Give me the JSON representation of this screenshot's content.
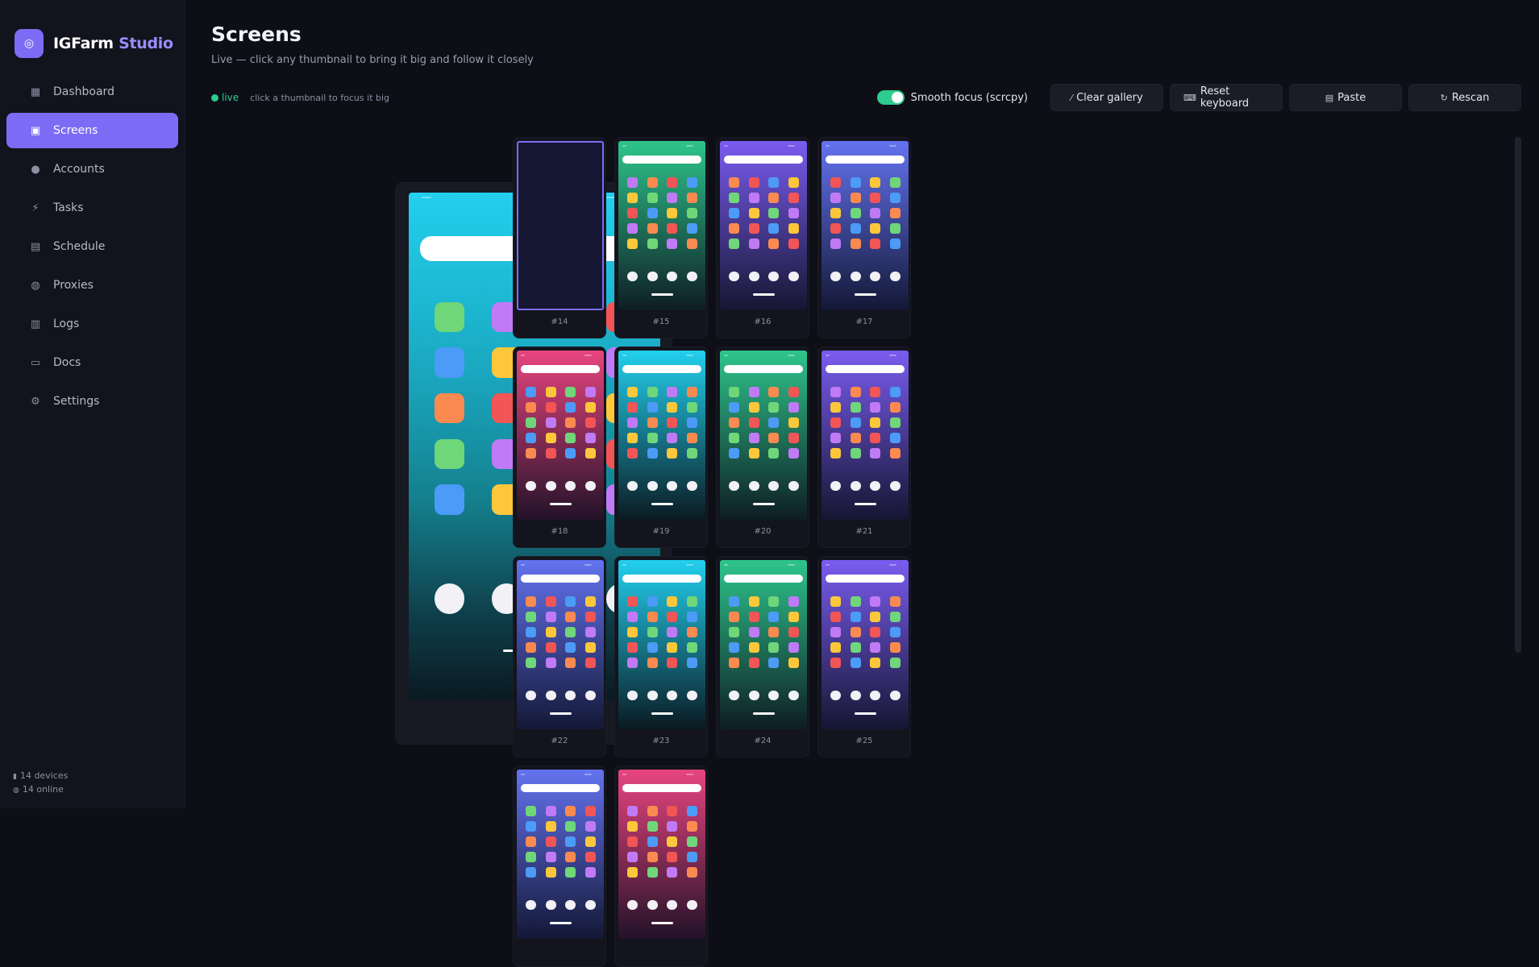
{
  "brand": {
    "name": "IGFarm",
    "accent": "Studio",
    "logo_icon": "camera-icon"
  },
  "sidebar": {
    "items": [
      {
        "label": "Dashboard",
        "icon": "dashboard-icon",
        "glyph": "▦",
        "active": false
      },
      {
        "label": "Screens",
        "icon": "screens-icon",
        "glyph": "▣",
        "active": true
      },
      {
        "label": "Accounts",
        "icon": "user-icon",
        "glyph": "●",
        "active": false
      },
      {
        "label": "Tasks",
        "icon": "bolt-icon",
        "glyph": "⚡",
        "active": false
      },
      {
        "label": "Schedule",
        "icon": "calendar-icon",
        "glyph": "▤",
        "active": false
      },
      {
        "label": "Proxies",
        "icon": "globe-icon",
        "glyph": "◍",
        "active": false
      },
      {
        "label": "Logs",
        "icon": "document-icon",
        "glyph": "▥",
        "active": false
      },
      {
        "label": "Docs",
        "icon": "book-icon",
        "glyph": "▭",
        "active": false
      },
      {
        "label": "Settings",
        "icon": "gear-icon",
        "glyph": "⚙",
        "active": false
      }
    ],
    "footer": {
      "devices": "14 devices",
      "online": "14 online"
    }
  },
  "header": {
    "title": "Screens",
    "subtitle": "Live — click any thumbnail to bring it big and follow it closely"
  },
  "toolbar": {
    "live_label": "live",
    "live_hint": "click a thumbnail to focus it big",
    "smooth_focus_label": "Smooth focus (scrcpy)",
    "smooth_focus_on": true,
    "clear_gallery": "Clear gallery",
    "reset_keyboard": "Reset keyboard",
    "paste": "Paste",
    "rescan": "Rescan"
  },
  "focused": {
    "label": "#14"
  },
  "thumbnails": [
    {
      "label": "#14",
      "theme": "blank",
      "selected": true
    },
    {
      "label": "#15",
      "theme": "green"
    },
    {
      "label": "#16",
      "theme": "purple"
    },
    {
      "label": "#17",
      "theme": "indigo"
    },
    {
      "label": "#18",
      "theme": "pink"
    },
    {
      "label": "#19",
      "theme": "cyan"
    },
    {
      "label": "#20",
      "theme": "green"
    },
    {
      "label": "#21",
      "theme": "purple"
    },
    {
      "label": "#22",
      "theme": "indigo"
    },
    {
      "label": "#23",
      "theme": "cyan"
    },
    {
      "label": "#24",
      "theme": "green"
    },
    {
      "label": "#25",
      "theme": "purple"
    },
    {
      "label": "",
      "theme": "indigo"
    },
    {
      "label": "",
      "theme": "pink"
    }
  ],
  "colors": {
    "accent": "#7c6cf5",
    "live": "#2ecc8f",
    "app_palette": [
      "#6fd67a",
      "#c07af5",
      "#fa8a50",
      "#f25555",
      "#4c9bf6",
      "#fcc73a"
    ],
    "themes": {
      "green": [
        "#2ec58c",
        "#0e1d24"
      ],
      "purple": [
        "#7a5cf0",
        "#151632"
      ],
      "indigo": [
        "#6473f0",
        "#131836"
      ],
      "pink": [
        "#e8457f",
        "#231229"
      ],
      "cyan": [
        "#22d0ee",
        "#0a1a22"
      ]
    }
  }
}
